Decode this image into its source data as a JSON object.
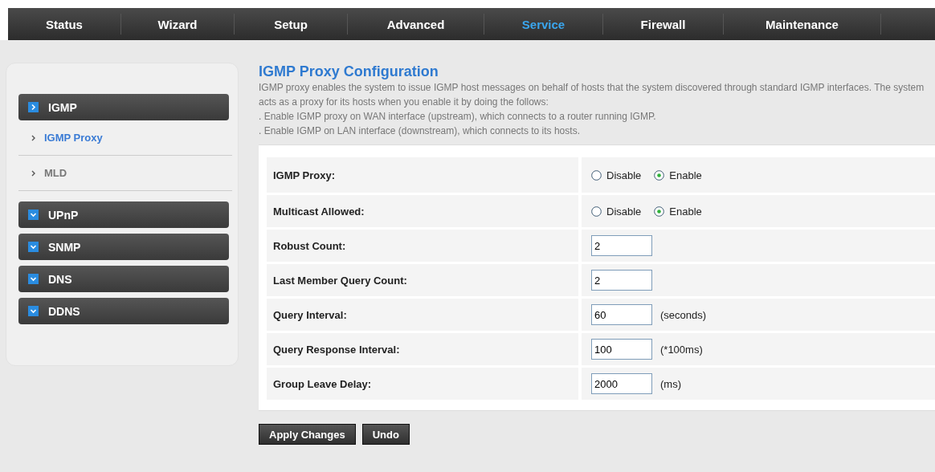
{
  "nav": {
    "tabs": [
      {
        "label": "Status",
        "selected": false
      },
      {
        "label": "Wizard",
        "selected": false
      },
      {
        "label": "Setup",
        "selected": false
      },
      {
        "label": "Advanced",
        "selected": false
      },
      {
        "label": "Service",
        "selected": true
      },
      {
        "label": "Firewall",
        "selected": false
      },
      {
        "label": "Maintenance",
        "selected": false
      }
    ]
  },
  "sidebar": {
    "groups": [
      {
        "label": "IGMP",
        "expanded": true,
        "children": [
          {
            "label": "IGMP Proxy",
            "selected": true
          },
          {
            "label": "MLD",
            "selected": false
          }
        ]
      },
      {
        "label": "UPnP",
        "expanded": false
      },
      {
        "label": "SNMP",
        "expanded": false
      },
      {
        "label": "DNS",
        "expanded": false
      },
      {
        "label": "DDNS",
        "expanded": false
      }
    ]
  },
  "page": {
    "title": "IGMP Proxy Configuration",
    "description": [
      "IGMP proxy enables the system to issue IGMP host messages on behalf of hosts that the system discovered through standard IGMP interfaces. The system acts as a proxy for its hosts when you enable it by doing the follows:",
      ". Enable IGMP proxy on WAN interface (upstream), which connects to a router running IGMP.",
      ". Enable IGMP on LAN interface (downstream), which connects to its hosts."
    ]
  },
  "form": {
    "rows": [
      {
        "kind": "radio",
        "label": "IGMP Proxy:",
        "options": [
          {
            "label": "Disable",
            "selected": false
          },
          {
            "label": "Enable",
            "selected": true
          }
        ]
      },
      {
        "kind": "radio",
        "label": "Multicast Allowed:",
        "options": [
          {
            "label": "Disable",
            "selected": false
          },
          {
            "label": "Enable",
            "selected": true
          }
        ]
      },
      {
        "kind": "input",
        "label": "Robust Count:",
        "value": "2"
      },
      {
        "kind": "input",
        "label": "Last Member Query Count:",
        "value": "2"
      },
      {
        "kind": "input",
        "label": "Query Interval:",
        "value": "60",
        "unit": "(seconds)"
      },
      {
        "kind": "input",
        "label": "Query Response Interval:",
        "value": "100",
        "unit": "(*100ms)"
      },
      {
        "kind": "input",
        "label": "Group Leave Delay:",
        "value": "2000",
        "unit": "(ms)"
      }
    ]
  },
  "buttons": [
    "Apply Changes",
    "Undo"
  ]
}
